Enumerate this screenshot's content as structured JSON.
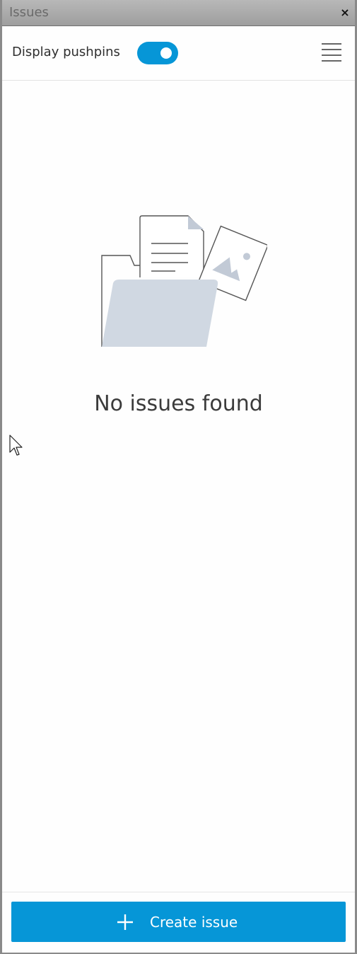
{
  "window": {
    "title": "Issues",
    "close_glyph": "×"
  },
  "toolbar": {
    "toggle_label": "Display pushpins",
    "toggle_on": true,
    "menu_icon": "hamburger-menu-icon"
  },
  "empty_state": {
    "icon": "folder-documents-illustration-icon",
    "message": "No issues found"
  },
  "footer": {
    "create_label": "Create issue",
    "create_icon": "plus-icon"
  },
  "colors": {
    "accent": "#0696d7",
    "illustration_fill": "#d0d8e2",
    "text": "#3b3b3b"
  }
}
